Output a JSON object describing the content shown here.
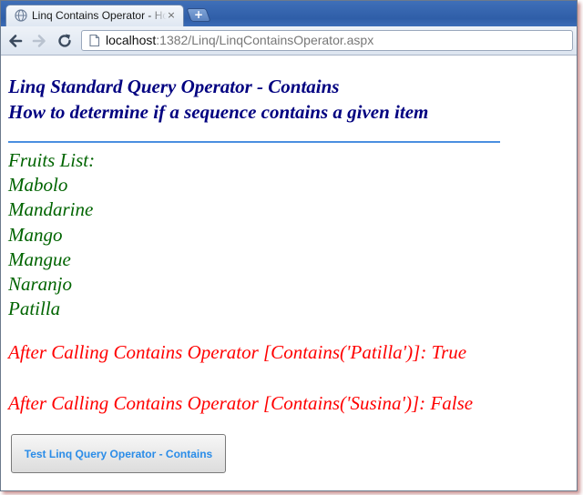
{
  "browser": {
    "tab": {
      "title": "Linq Contains Operator - Home",
      "close_glyph": "×"
    },
    "new_tab_glyph": "+",
    "address": {
      "host": "localhost",
      "rest": ":1382/Linq/LinqContainsOperator.aspx"
    },
    "icons": {
      "tab_favicon": "globe-icon",
      "back": "back-arrow-icon",
      "forward": "forward-arrow-icon",
      "reload": "reload-icon",
      "page": "page-icon"
    }
  },
  "page": {
    "heading_line1": "Linq Standard Query Operator - Contains",
    "heading_line2": "How to determine if a sequence contains a given item",
    "fruits_label": "Fruits List:",
    "fruits": [
      "Mabolo",
      "Mandarine",
      "Mango",
      "Mangue",
      "Naranjo",
      "Patilla"
    ],
    "result1": "After Calling Contains Operator [Contains('Patilla')]: True",
    "result2": "After Calling Contains Operator [Contains('Susina')]: False",
    "button_label": "Test Linq Query Operator - Contains"
  },
  "colors": {
    "heading": "#000080",
    "rule": "#4a8fe0",
    "fruits": "#006400",
    "result": "#ff0000",
    "button_text": "#2a8ce8"
  }
}
